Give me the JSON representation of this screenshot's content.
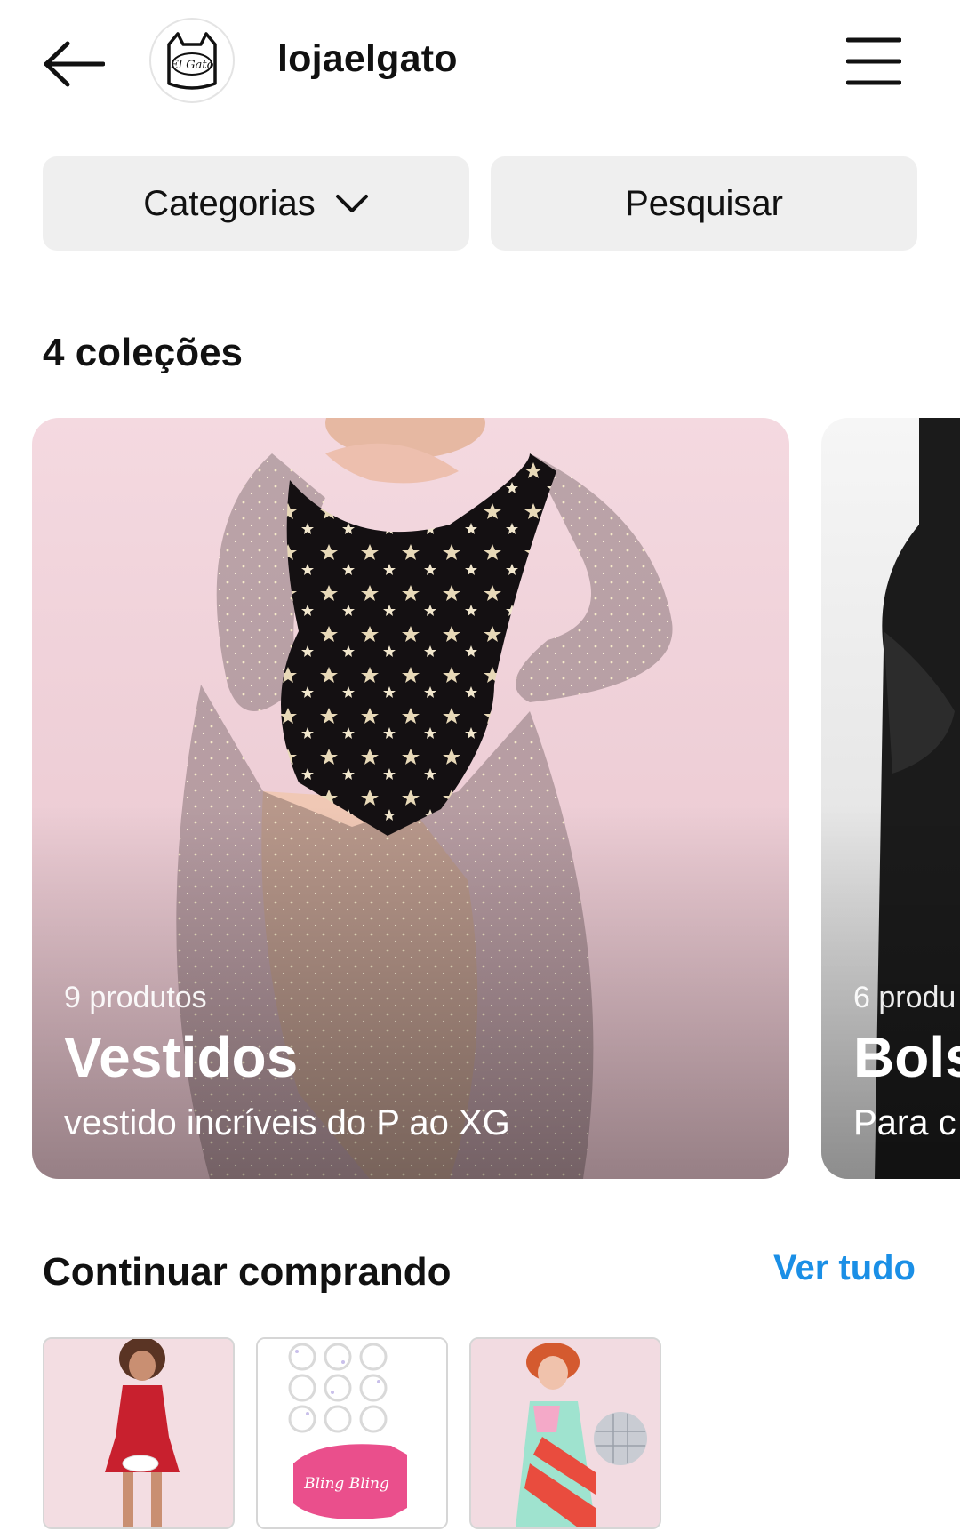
{
  "header": {
    "username": "lojaelgato",
    "avatar_logo_text": "El Gato",
    "back_icon": "arrow-left-icon",
    "menu_icon": "hamburger-menu-icon"
  },
  "filters": {
    "categories_label": "Categorias",
    "search_label": "Pesquisar"
  },
  "collections": {
    "title": "4 coleções",
    "items": [
      {
        "count": "9 produtos",
        "title": "Vestidos",
        "description": "vestido incríveis do P ao XG"
      },
      {
        "count": "6 produ",
        "title": "Bols",
        "description": "Para c"
      }
    ]
  },
  "continue_shopping": {
    "title": "Continuar comprando",
    "see_all": "Ver tudo",
    "thumb_2_label": "Bling Bling"
  },
  "colors": {
    "accent_link": "#1a8fe6",
    "button_bg": "#efefef"
  }
}
